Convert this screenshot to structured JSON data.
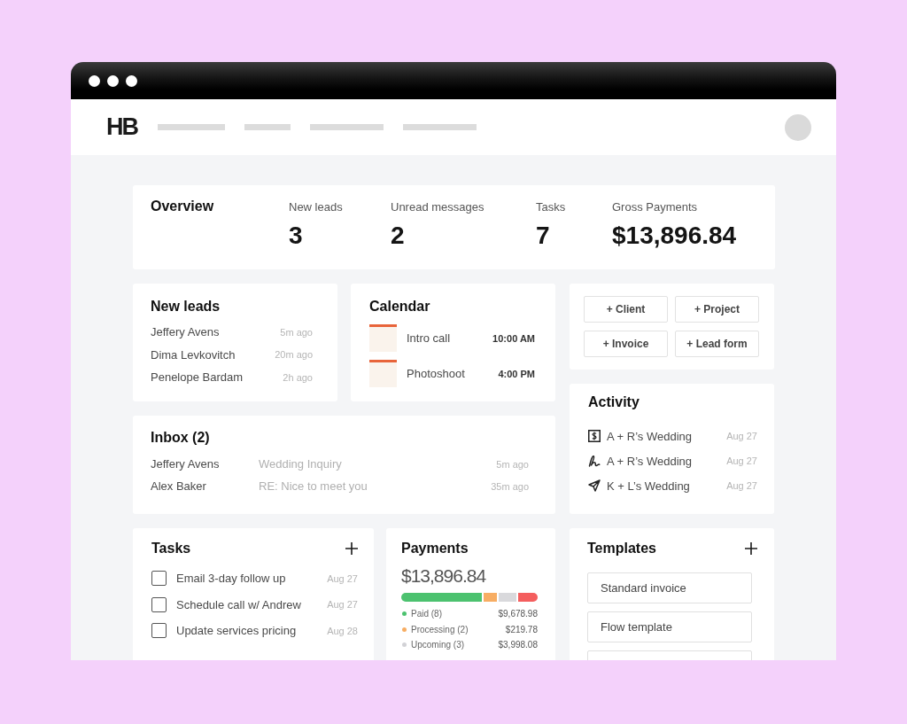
{
  "logo": "HB",
  "overview": {
    "title": "Overview",
    "stats": [
      {
        "label": "New leads",
        "value": "3"
      },
      {
        "label": "Unread messages",
        "value": "2"
      },
      {
        "label": "Tasks",
        "value": "7"
      },
      {
        "label": "Gross Payments",
        "value": "$13,896.84"
      }
    ]
  },
  "new_leads": {
    "title": "New leads",
    "items": [
      {
        "name": "Jeffery Avens",
        "time": "5m ago"
      },
      {
        "name": "Dima Levkovitch",
        "time": "20m ago"
      },
      {
        "name": "Penelope Bardam",
        "time": "2h ago"
      }
    ]
  },
  "calendar": {
    "title": "Calendar",
    "events": [
      {
        "name": "Intro call",
        "time": "10:00 AM"
      },
      {
        "name": "Photoshoot",
        "time": "4:00 PM"
      }
    ]
  },
  "quick_actions": [
    {
      "label": "+ Client"
    },
    {
      "label": "+ Project"
    },
    {
      "label": "+ Invoice"
    },
    {
      "label": "+ Lead form"
    }
  ],
  "activity": {
    "title": "Activity",
    "items": [
      {
        "kind": "invoice",
        "name": "A + R’s Wedding",
        "date": "Aug 27"
      },
      {
        "kind": "signature",
        "name": "A + R’s Wedding",
        "date": "Aug 27"
      },
      {
        "kind": "sent",
        "name": "K + L’s Wedding",
        "date": "Aug 27"
      }
    ]
  },
  "inbox": {
    "title": "Inbox (2)",
    "messages": [
      {
        "sender": "Jeffery Avens",
        "subject": "Wedding Inquiry",
        "time": "5m ago"
      },
      {
        "sender": "Alex Baker",
        "subject": "RE: Nice to meet you",
        "time": "35m ago"
      }
    ]
  },
  "tasks": {
    "title": "Tasks",
    "items": [
      {
        "label": "Email 3-day follow up",
        "date": "Aug 27",
        "checked": false
      },
      {
        "label": "Schedule call w/ Andrew",
        "date": "Aug 27",
        "checked": false
      },
      {
        "label": "Update services pricing",
        "date": "Aug 28",
        "checked": false
      }
    ]
  },
  "payments": {
    "title": "Payments",
    "total": "$13,896.84",
    "bar": [
      {
        "color": "#4cc26f"
      },
      {
        "color": "#f7ad63"
      },
      {
        "color": "#d9d9dc"
      },
      {
        "color": "#f45e5e"
      }
    ],
    "legend": [
      {
        "label": "Paid (8)",
        "amount": "$9,678.98",
        "color": "#4cc26f"
      },
      {
        "label": "Processing (2)",
        "amount": "$219.78",
        "color": "#f7ad63"
      },
      {
        "label": "Upcoming (3)",
        "amount": "$3,998.08",
        "color": "#d2d2d6"
      }
    ]
  },
  "templates": {
    "title": "Templates",
    "items": [
      {
        "name": "Standard invoice"
      },
      {
        "name": "Flow template"
      }
    ],
    "more_below": true
  }
}
